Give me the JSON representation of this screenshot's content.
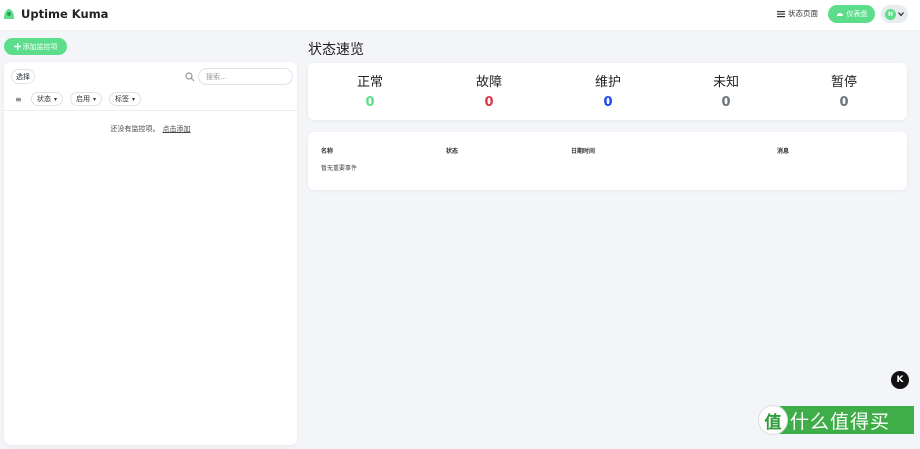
{
  "header": {
    "app_title": "Uptime Kuma",
    "status_page_label": "状态页面",
    "settings_label": "仪表盘",
    "avatar_letter": "H"
  },
  "sidebar": {
    "add_monitor_label": "添加监控项",
    "select_label": "选择",
    "search_placeholder": "搜索...",
    "filters": [
      "状态",
      "启用",
      "标签"
    ],
    "empty_text": "还没有监控项。",
    "empty_link": "点击添加"
  },
  "overview": {
    "title": "状态速览",
    "stats": [
      {
        "label": "正常",
        "value": "0",
        "color": "#5cdd8b"
      },
      {
        "label": "故障",
        "value": "0",
        "color": "#dc3545"
      },
      {
        "label": "维护",
        "value": "0",
        "color": "#1747f5"
      },
      {
        "label": "未知",
        "value": "0",
        "color": "#6c757d"
      },
      {
        "label": "暂停",
        "value": "0",
        "color": "#6c757d"
      }
    ]
  },
  "events": {
    "columns": [
      "名称",
      "状态",
      "日期时间",
      "消息"
    ],
    "empty_text": "暂无重要事件"
  },
  "badge": {
    "letter": "K"
  },
  "watermark": {
    "icon": "值",
    "text": "什么值得买"
  },
  "colors": {
    "accent": "#5cdd8b",
    "background": "#f3f5f8"
  }
}
